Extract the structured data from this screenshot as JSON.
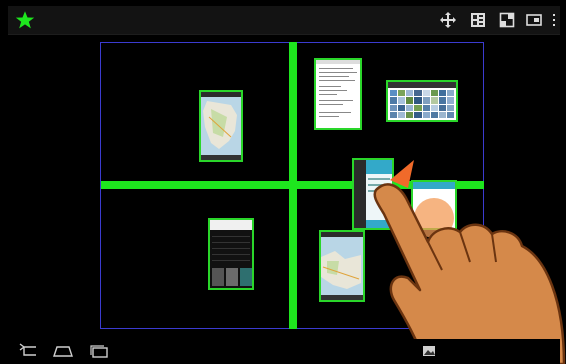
{
  "app": {
    "title": ""
  },
  "toolbar": {
    "icons": [
      "star-icon",
      "move-icon",
      "grid-layout-icon",
      "fullscreen-icon",
      "display-icon",
      "overflow-menu-icon"
    ],
    "accent_color": "#1ee61e"
  },
  "workspace": {
    "divider_color": "#1ee61e",
    "frame_color": "#3b3bd0",
    "tiles": [
      {
        "name": "map-tile-top-left",
        "kind": "map"
      },
      {
        "name": "document-tile",
        "kind": "document"
      },
      {
        "name": "photo-gallery-tile",
        "kind": "gallery"
      },
      {
        "name": "dragged-app-tile",
        "kind": "app"
      },
      {
        "name": "settings-tile",
        "kind": "settings"
      },
      {
        "name": "map-tile-bottom",
        "kind": "map"
      },
      {
        "name": "small-app-tile",
        "kind": "app"
      }
    ]
  },
  "navbar": {
    "icons": [
      "back-icon",
      "home-icon",
      "recent-apps-icon",
      "gallery-icon"
    ]
  }
}
